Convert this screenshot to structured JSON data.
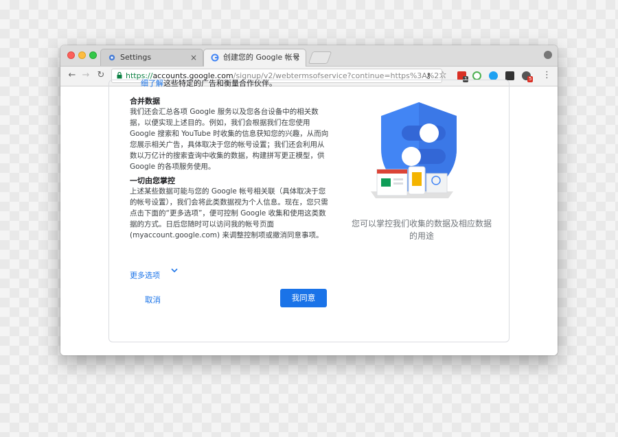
{
  "tabs": [
    {
      "label": "Settings",
      "close": "×"
    },
    {
      "label": "创建您的 Google 帐号",
      "close": "×"
    }
  ],
  "toolbar": {
    "back": "←",
    "forward": "→",
    "reload": "↻",
    "url_scheme": "https://",
    "url_host": "accounts.google.com",
    "url_path": "/signup/v2/webtermsofservice?continue=https%3A%2...",
    "badges": [
      "1",
      "5"
    ]
  },
  "content": {
    "top_link": "细了解",
    "top_text": "这些特定的广告和衡量合作伙伴。",
    "section1_title": "合并数据",
    "section1_body": "我们还会汇总各项 Google 服务以及您各台设备中的相关数据，以便实现上述目的。例如，我们会根据我们在您使用 Google 搜索和 YouTube 时收集的信息获知您的兴趣，从而向您展示相关广告，具体取决于您的帐号设置；我们还会利用从数以万亿计的搜索查询中收集的数据，构建拼写更正模型，供 Google 的各项服务使用。",
    "section2_title": "一切由您掌控",
    "section2_body": "上述某些数据可能与您的 Google 帐号相关联（具体取决于您的帐号设置），我们会将此类数据视为个人信息。现在，您只需点击下面的“更多选项”，便可控制 Google 收集和使用这类数据的方式。日后您随时可以访问我的帐号页面 (myaccount.google.com) 来调整控制项或撤消同意事项。",
    "more_options": "更多选项",
    "cancel": "取消",
    "agree": "我同意",
    "caption": "您可以掌控我们收集的数据及相应数据的用途"
  },
  "colors": {
    "accent": "#1a73e8",
    "shield": "#4285f4",
    "shield_dark": "#3367d6"
  }
}
